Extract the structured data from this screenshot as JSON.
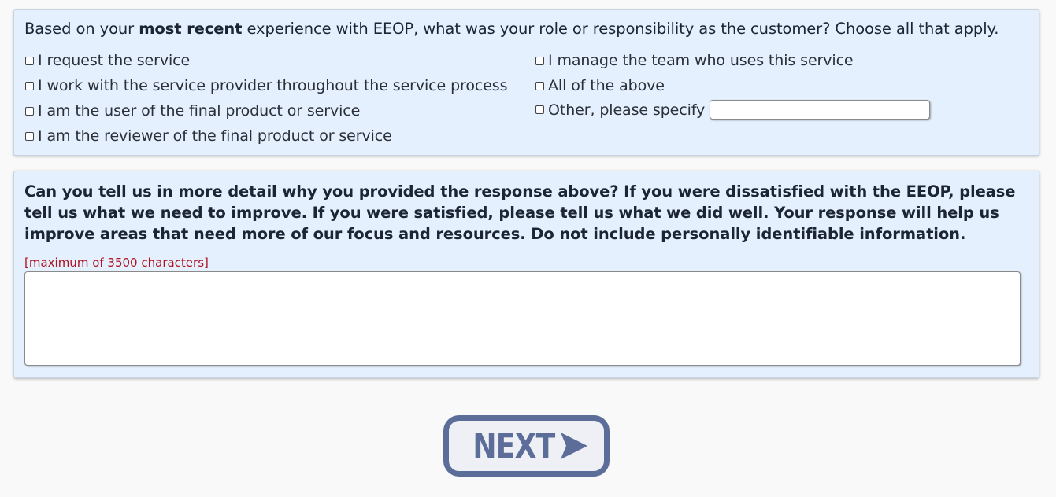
{
  "question1": {
    "pre": "Based on your ",
    "bold": "most recent",
    "post": " experience with EEOP, what was your role or responsibility as the customer? Choose all that apply.",
    "options": [
      {
        "label": "I request the service",
        "checked": false
      },
      {
        "label": "I work with the service provider throughout the service process",
        "checked": false
      },
      {
        "label": "I am the user of the final product or service",
        "checked": false
      },
      {
        "label": "I am the reviewer of the final product or service",
        "checked": false
      },
      {
        "label": "I manage the team who uses this service",
        "checked": false
      },
      {
        "label": "All of the above",
        "checked": false
      },
      {
        "label": "Other, please specify",
        "checked": false
      }
    ],
    "other_value": ""
  },
  "question2": {
    "text": "Can you tell us in more detail why you provided the response above? If you were dissatisfied with the EEOP, please tell us what we need to improve. If you were satisfied, please tell us what we did well. Your response will help us improve areas that need more of our focus and resources. Do not include personally identifiable information.",
    "max_chars_note": "[maximum of 3500 characters]",
    "value": ""
  },
  "next_button": {
    "label": "NEXT"
  },
  "colors": {
    "panel_bg": "#e4f0fd",
    "button_accent": "#5c6d99",
    "note_red": "#b0111d"
  }
}
